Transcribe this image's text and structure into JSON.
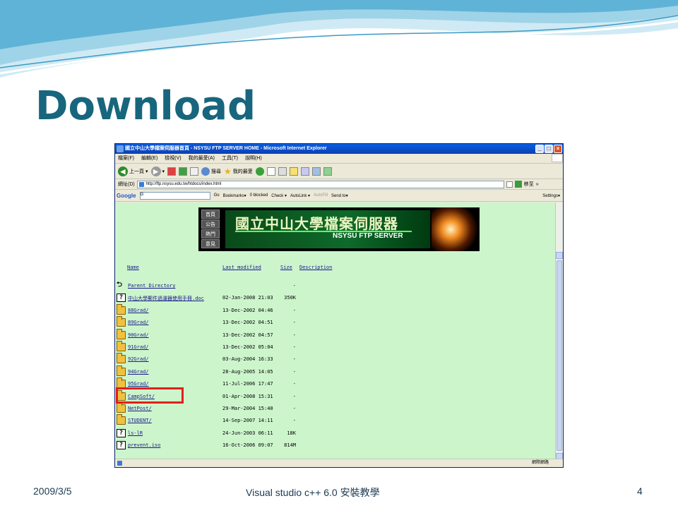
{
  "slide": {
    "title": "Download",
    "footer_date": "2009/3/5",
    "footer_center": "Visual studio c++ 6.0 安裝教學",
    "page_number": "4"
  },
  "colors": {
    "title": "#17667d",
    "content_bg": "#ccf5cc",
    "highlight": "#e0201a"
  },
  "window": {
    "title": "國立中山大學檔案伺服器首頁 - NSYSU FTP SERVER HOME - Microsoft Internet Explorer",
    "minimize": "_",
    "maximize": "□",
    "close": "×"
  },
  "menu": [
    "檔案(F)",
    "編輯(E)",
    "檢視(V)",
    "我的最愛(A)",
    "工具(T)",
    "說明(H)"
  ],
  "toolbar": {
    "back": "上一頁",
    "search": "搜尋",
    "favorites": "我的最愛"
  },
  "address": {
    "label": "網址(D)",
    "url": "http://ftp.nsysu.edu.tw/htdocs/index.html",
    "go": "移至",
    "more": "»"
  },
  "google": {
    "logo": "Google",
    "box_prefix": "G",
    "go": "Go",
    "bookmarks": "Bookmarks▾",
    "blocked": "0 blocked",
    "check": "Check ▾",
    "autolink": "AutoLink ▾",
    "autofill": "AutoFill",
    "sendto": "Send to▾",
    "settings": "Settings▾"
  },
  "banner": {
    "nav": [
      "首頁",
      "公告",
      "熱門",
      "意見"
    ],
    "chinese": "國立中山大學檔案伺服器",
    "english": "NSYSU FTP SERVER"
  },
  "listing": {
    "headers": {
      "name": "Name",
      "modified": "Last modified",
      "size": "Size",
      "description": "Description"
    },
    "rows": [
      {
        "icon": "back",
        "name": "Parent Directory",
        "date": "",
        "size": "-"
      },
      {
        "icon": "unknown",
        "name": "中山大學郵件過濾器使用手冊.doc",
        "date": "02-Jan-2008 21:03",
        "size": "350K"
      },
      {
        "icon": "folder",
        "name": "88Grad/",
        "date": "13-Dec-2002 04:46",
        "size": "-"
      },
      {
        "icon": "folder",
        "name": "89Grad/",
        "date": "13-Dec-2002 04:51",
        "size": "-"
      },
      {
        "icon": "folder",
        "name": "90Grad/",
        "date": "13-Dec-2002 04:57",
        "size": "-"
      },
      {
        "icon": "folder",
        "name": "91Grad/",
        "date": "13-Dec-2002 05:04",
        "size": "-"
      },
      {
        "icon": "folder",
        "name": "92Grad/",
        "date": "03-Aug-2004 16:33",
        "size": "-"
      },
      {
        "icon": "folder",
        "name": "94Grad/",
        "date": "28-Aug-2005 14:05",
        "size": "-"
      },
      {
        "icon": "folder",
        "name": "95Grad/",
        "date": "11-Jul-2006 17:47",
        "size": "-"
      },
      {
        "icon": "folder",
        "name": "CampSoft/",
        "date": "01-Apr-2008 15:31",
        "size": "-"
      },
      {
        "icon": "folder",
        "name": "NetPost/",
        "date": "29-Mar-2004 15:40",
        "size": "-"
      },
      {
        "icon": "folder",
        "name": "STUDENT/",
        "date": "14-Sep-2007 14:11",
        "size": "-"
      },
      {
        "icon": "unknown",
        "name": "ls-lR",
        "date": "24-Jun-2003 06:11",
        "size": "18K"
      },
      {
        "icon": "unknown",
        "name": "prevent.iso",
        "date": "16-Oct-2006 09:07",
        "size": "814M"
      }
    ]
  },
  "status": {
    "zone": "網際網路"
  }
}
